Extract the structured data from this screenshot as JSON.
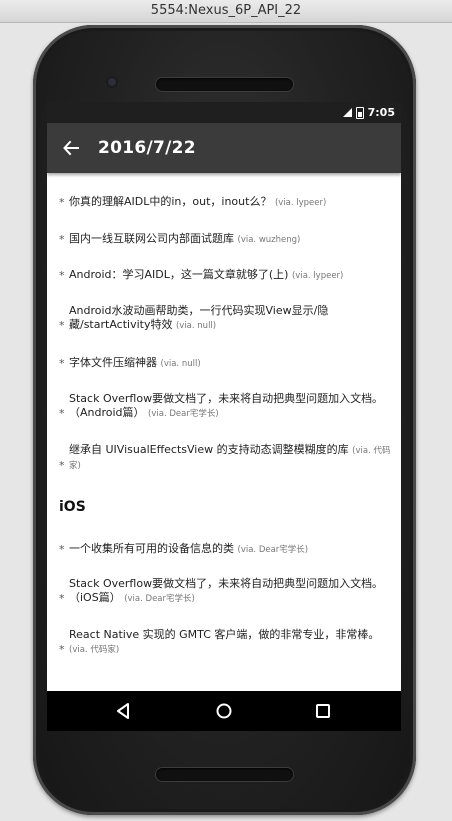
{
  "window": {
    "title": "5554:Nexus_6P_API_22"
  },
  "status_bar": {
    "time": "7:05"
  },
  "toolbar": {
    "title": "2016/7/22"
  },
  "items_a": [
    {
      "text": "你真的理解AIDL中的in，out，inout么？",
      "via": "(via. lypeer)"
    },
    {
      "text": "国内一线互联网公司内部面试题库",
      "via": "(via. wuzheng)"
    },
    {
      "text": " Android：学习AIDL，这一篇文章就够了(上)",
      "via": "(via. lypeer)"
    },
    {
      "text": "Android水波动画帮助类，一行代码实现View显示/隐藏/startActivity特效",
      "via": "(via. null)"
    },
    {
      "text": "字体文件压缩神器",
      "via": "(via. null)"
    },
    {
      "text": "Stack Overflow要做文档了，未来将自动把典型问题加入文档。（Android篇）",
      "via": "(via. Dear宅学长)"
    },
    {
      "text": "继承自 UIVisualEffectsView 的支持动态调整模糊度的库",
      "via": "(via. 代码家)"
    }
  ],
  "section_ios": {
    "heading": "iOS"
  },
  "items_b": [
    {
      "text": "一个收集所有可用的设备信息的类",
      "via": "(via. Dear宅学长)"
    },
    {
      "text": "Stack Overflow要做文档了，未来将自动把典型问题加入文档。（iOS篇）",
      "via": "(via. Dear宅学长)"
    },
    {
      "text": "React Native 实现的 GMTC 客户端，做的非常专业，非常棒。",
      "via": "(via. 代码家)"
    }
  ],
  "bullet": "*",
  "nav": {
    "icons": [
      "triangle-back-icon",
      "circle-home-icon",
      "square-recents-icon"
    ]
  }
}
